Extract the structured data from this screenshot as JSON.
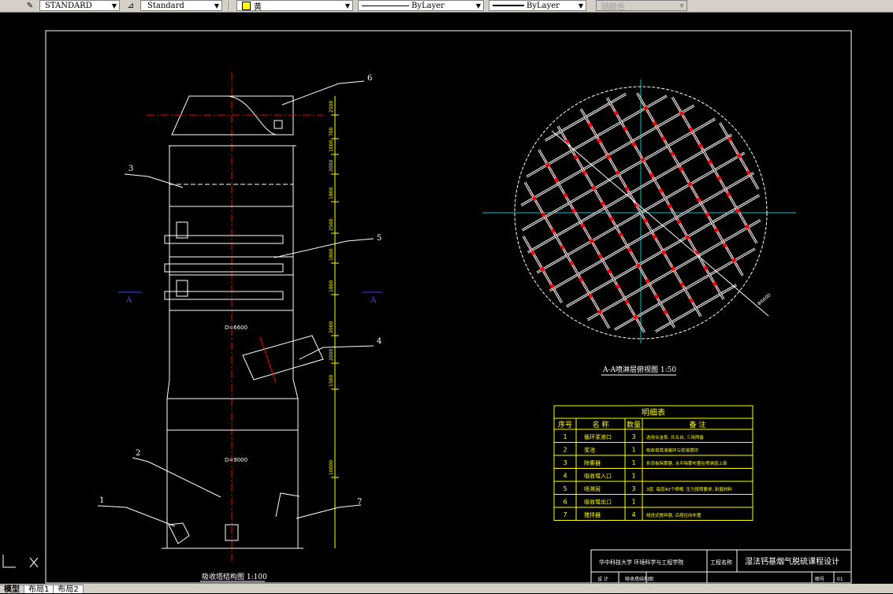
{
  "toolbar": {
    "text_style": "STANDARD",
    "dim_style": "Standard",
    "color": "黄",
    "linetype": "ByLayer",
    "lineweight": "ByLayer",
    "plot_style": "随颜色"
  },
  "drawing": {
    "tower_caption": "吸收塔结构图 1:100",
    "section_caption": "A-A喷淋层俯视图 1:50",
    "section_marks": [
      "A",
      "A"
    ],
    "callouts": [
      "1",
      "2",
      "3",
      "4",
      "5",
      "6",
      "7"
    ],
    "dim_upper": "D=6600",
    "dim_lower": "D=9000",
    "dim_angle": "Φ6600",
    "height_dims": [
      "2500",
      "700",
      "1000",
      "2000",
      "1800",
      "2500",
      "1800",
      "1800",
      "2000",
      "2000",
      "1500",
      "10000"
    ]
  },
  "bom": {
    "title": "明细表",
    "headers": [
      "序号",
      "名 称",
      "数量",
      "备 注"
    ],
    "rows": [
      {
        "no": "1",
        "name": "循环浆液口",
        "qty": "3",
        "note": "选用合金泵, 共五台, 三用两备"
      },
      {
        "no": "2",
        "name": "浆池",
        "qty": "1",
        "note": "吸收塔浆液循环与浆液搅拌"
      },
      {
        "no": "3",
        "name": "除雾器",
        "qty": "1",
        "note": "折流板除雾器, 水平除雾布置在喷淋层上部"
      },
      {
        "no": "4",
        "name": "吸收塔入口",
        "qty": "1",
        "note": ""
      },
      {
        "no": "5",
        "name": "喷淋层",
        "qty": "3",
        "note": "3层, 每层40个喷嘴, 压力按照要求, 耐磨材料"
      },
      {
        "no": "6",
        "name": "吸收塔出口",
        "qty": "1",
        "note": ""
      },
      {
        "no": "7",
        "name": "搅拌器",
        "qty": "4",
        "note": "侧进式搅拌器, 沿塔径向布置"
      }
    ]
  },
  "title_block": {
    "school": "华中科技大学 环境科学与工程学院",
    "project_label": "工程名称",
    "project_name": "湿法钙基烟气脱硫课程设计",
    "design_label": "设 计",
    "sheet_label": "图号",
    "drawing_label": "吸收塔结构图",
    "sheet_no": "01"
  },
  "tabs": [
    {
      "label": "模型",
      "active": true
    },
    {
      "label": "布局1",
      "active": false
    },
    {
      "label": "布局2",
      "active": false
    }
  ],
  "colors": {
    "white": "#ffffff",
    "red": "#ff0000",
    "yellow": "#ffff00",
    "cyan": "#00c8c8",
    "blue": "#4040ff",
    "background": "#000000"
  }
}
